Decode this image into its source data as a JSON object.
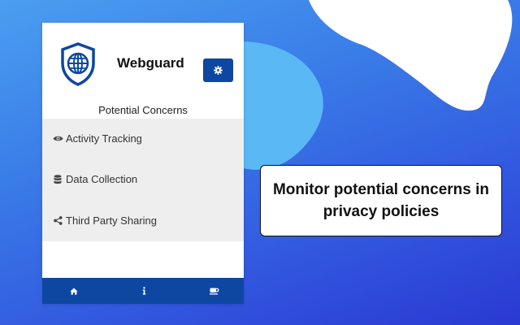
{
  "app": {
    "name": "Webguard",
    "logo_icon": "shield-globe-icon",
    "settings_icon": "gear-icon"
  },
  "concerns": {
    "title": "Potential Concerns",
    "items": [
      {
        "label": "Activity Tracking",
        "icon": "eye-icon"
      },
      {
        "label": "Data Collection",
        "icon": "database-icon"
      },
      {
        "label": "Third Party Sharing",
        "icon": "share-icon"
      }
    ]
  },
  "footer": {
    "items": [
      {
        "icon": "home-icon"
      },
      {
        "icon": "info-icon"
      },
      {
        "icon": "coffee-icon"
      }
    ]
  },
  "callout": {
    "text": "Monitor potential concerns in privacy policies"
  },
  "colors": {
    "primary": "#0d47a1",
    "list_bg": "#eeeeee",
    "bg_light_blob": "#5ab8f5",
    "background_gradient": [
      "#4a9ef0",
      "#2a39d2"
    ]
  }
}
